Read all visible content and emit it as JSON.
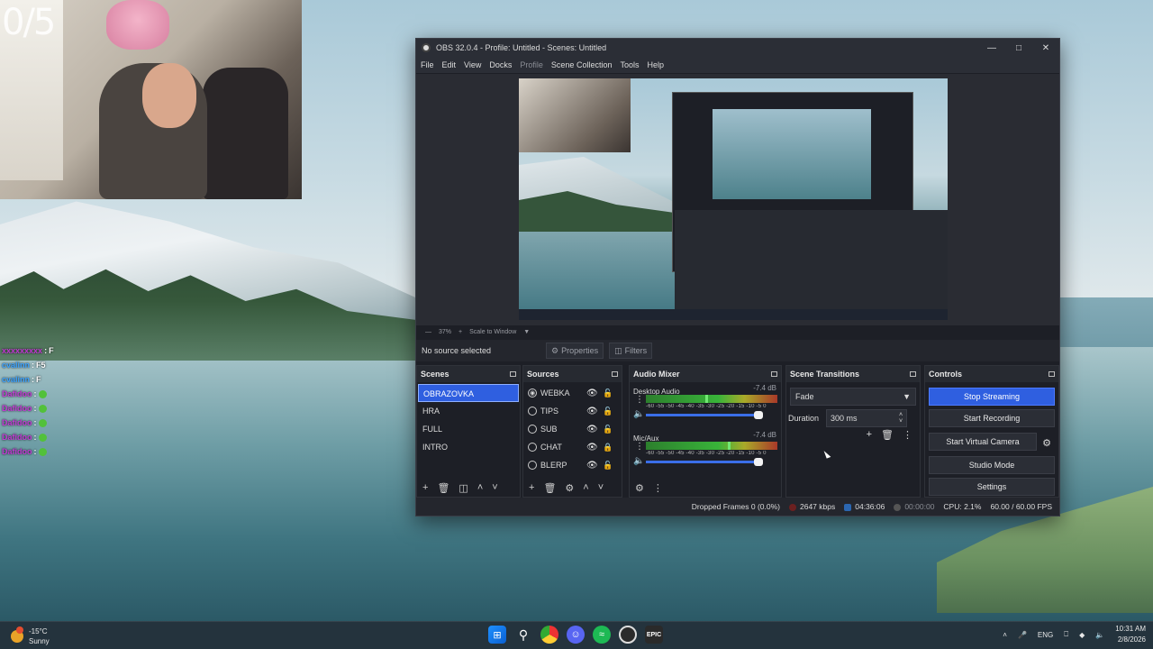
{
  "webcam": {
    "counter": "0/5"
  },
  "chat": [
    {
      "user": "xxxxxxxxx",
      "msg": "F",
      "color": "#c23bd4",
      "emote": false
    },
    {
      "user": "cvalinn",
      "msg": "F5",
      "color": "#3ba3ff",
      "emote": false
    },
    {
      "user": "cvalinn",
      "msg": "F",
      "color": "#3ba3ff",
      "emote": false
    },
    {
      "user": "Dafidoo",
      "msg": "",
      "color": "#c23bd4",
      "emote": true
    },
    {
      "user": "Dafidoo",
      "msg": "",
      "color": "#c23bd4",
      "emote": true
    },
    {
      "user": "Dafidoo",
      "msg": "",
      "color": "#c23bd4",
      "emote": true
    },
    {
      "user": "Dafidoo",
      "msg": "",
      "color": "#c23bd4",
      "emote": true
    },
    {
      "user": "Dafidoo",
      "msg": "",
      "color": "#c23bd4",
      "emote": true
    }
  ],
  "obs": {
    "title": "OBS 32.0.4 - Profile: Untitled - Scenes: Untitled",
    "menu": [
      "File",
      "Edit",
      "View",
      "Docks",
      "Profile",
      "Scene Collection",
      "Tools",
      "Help"
    ],
    "preview_bar": {
      "zoom": "37%",
      "scale_mode": "Scale to Window"
    },
    "source_bar": {
      "no_selection": "No source selected",
      "properties": "Properties",
      "filters": "Filters"
    },
    "scenes": {
      "title": "Scenes",
      "items": [
        "OBRAZOVKA",
        "HRA",
        "FULL",
        "INTRO"
      ],
      "active": "OBRAZOVKA"
    },
    "sources": {
      "title": "Sources",
      "items": [
        {
          "name": "WEBKA",
          "type": "camera-icon",
          "locked": false
        },
        {
          "name": "TIPS",
          "type": "globe-icon",
          "locked": false
        },
        {
          "name": "SUB",
          "type": "globe-icon",
          "locked": false
        },
        {
          "name": "CHAT",
          "type": "globe-icon",
          "locked": true
        },
        {
          "name": "BLERP",
          "type": "globe-icon",
          "locked": false
        }
      ]
    },
    "mixer": {
      "title": "Audio Mixer",
      "scale": "-60 -55 -50 -45 -40 -35 -30 -25 -20 -15 -10 -5 0",
      "channels": [
        {
          "name": "Desktop Audio",
          "db": "-7.4 dB",
          "level": 0.45,
          "volume": 0.86
        },
        {
          "name": "Mic/Aux",
          "db": "-7.4 dB",
          "level": 0.62,
          "volume": 0.86
        }
      ]
    },
    "transitions": {
      "title": "Scene Transitions",
      "selected": "Fade",
      "duration_label": "Duration",
      "duration_value": "300 ms"
    },
    "controls": {
      "title": "Controls",
      "stop_streaming": "Stop Streaming",
      "start_recording": "Start Recording",
      "start_virtual_camera": "Start Virtual Camera",
      "studio_mode": "Studio Mode",
      "settings": "Settings"
    },
    "status": {
      "dropped_frames": "Dropped Frames 0 (0.0%)",
      "bitrate": "2647 kbps",
      "stream_time": "04:36:06",
      "record_time": "00:00:00",
      "cpu": "CPU: 2.1%",
      "fps": "60.00 / 60.00 FPS"
    }
  },
  "taskbar": {
    "weather": {
      "temp": "-15°C",
      "condition": "Sunny"
    },
    "apps": [
      "windows-start-icon",
      "search-icon",
      "chrome-icon",
      "discord-icon",
      "spotify-icon",
      "obs-icon",
      "epic-games-icon"
    ],
    "lang": "ENG",
    "time": "10:31 AM",
    "date": "2/8/2026"
  },
  "colors": {
    "accent": "#2f5fe0",
    "panel": "#1d1f26",
    "panel_header": "#272a31"
  }
}
